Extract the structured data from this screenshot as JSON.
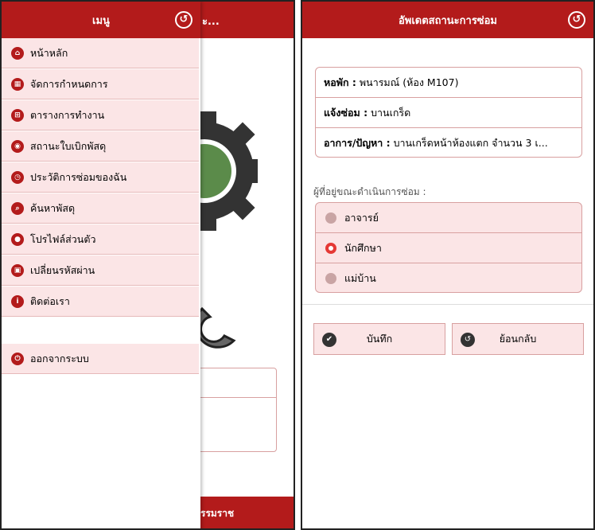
{
  "left_screen": {
    "menu_title": "เมนู",
    "underlying_title": "ะ...",
    "underlying_footer": "รรมราช",
    "menu_items": [
      {
        "label": "หน้าหลัก",
        "icon": "home-icon"
      },
      {
        "label": "จัดการกำหนดการ",
        "icon": "calendar-icon"
      },
      {
        "label": "ตารางการทำงาน",
        "icon": "grid-icon"
      },
      {
        "label": "สถานะใบเบิกพัสดุ",
        "icon": "eye-icon"
      },
      {
        "label": "ประวัติการซ่อมของฉัน",
        "icon": "history-icon"
      },
      {
        "label": "ค้นหาพัสดุ",
        "icon": "search-icon"
      },
      {
        "label": "โปรไฟล์ส่วนตัว",
        "icon": "user-icon"
      },
      {
        "label": "เปลี่ยนรหัสผ่าน",
        "icon": "lock-icon"
      },
      {
        "label": "ติดต่อเรา",
        "icon": "info-icon"
      }
    ],
    "logout_label": "ออกจากระบบ"
  },
  "right_screen": {
    "title": "อัพเดตสถานะการซ่อม",
    "info": {
      "dorm_label": "หอพัก :",
      "dorm_value": "พนารมณ์ (ห้อง M107)",
      "report_label": "แจ้งซ่อม :",
      "report_value": "บานเกร็ด",
      "symptom_label": "อาการ/ปัญหา :",
      "symptom_value": "บานเกร็ดหน้าห้องแตก จำนวน 3 เ..."
    },
    "present_label": "ผู้ที่อยู่ขณะดำเนินการซ่อม :",
    "options": [
      {
        "label": "อาจารย์",
        "checked": false
      },
      {
        "label": "นักศึกษา",
        "checked": true
      },
      {
        "label": "แม่บ้าน",
        "checked": false
      }
    ],
    "save_label": "บันทึก",
    "back_label": "ย้อนกลับ"
  },
  "colors": {
    "header": "#b31b1b",
    "item_bg": "#fbe5e6",
    "radio_checked": "#e53935"
  }
}
